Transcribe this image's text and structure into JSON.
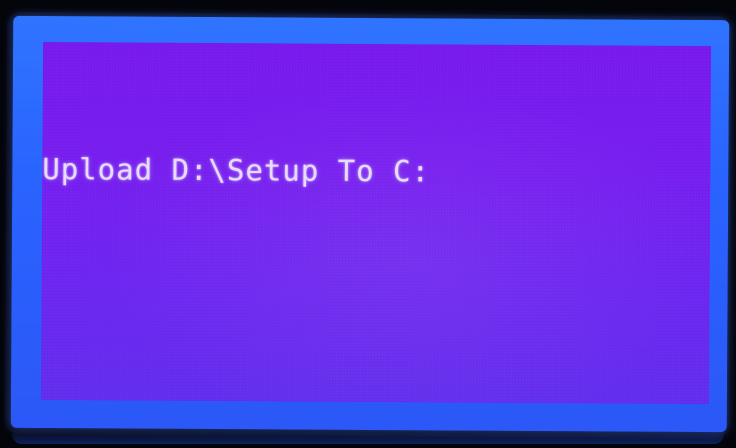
{
  "display": {
    "message": "Upload D:\\Setup To C:"
  },
  "colors": {
    "frame_blue": "#2f74ff",
    "screen_purple": "#7a20f4",
    "text": "#e6dcff"
  }
}
